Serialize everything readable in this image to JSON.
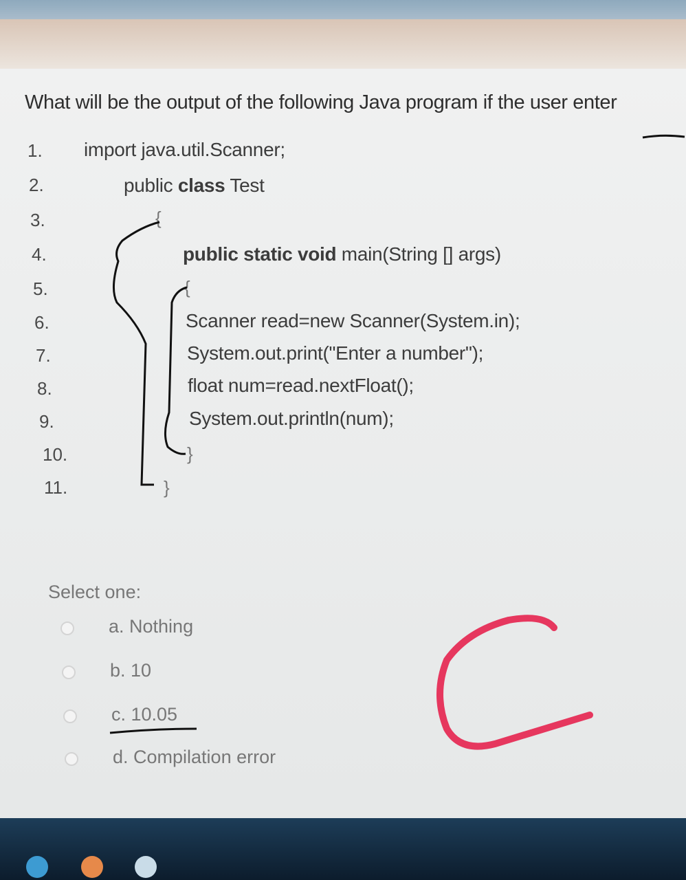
{
  "question": "What will be the output of the following Java program if the user enter",
  "code_lines": [
    {
      "n": "1.",
      "text": "import java.util.Scanner;"
    },
    {
      "n": "2.",
      "pre": "public ",
      "bold": "class",
      "post": " Test"
    },
    {
      "n": "3.",
      "text": ""
    },
    {
      "n": "4.",
      "bold": "public static void",
      "post": " main(String [] args)"
    },
    {
      "n": "5.",
      "text": ""
    },
    {
      "n": "6.",
      "text": "Scanner read=new Scanner(System.in);"
    },
    {
      "n": "7.",
      "text": "System.out.print(\"Enter a number\");"
    },
    {
      "n": "8.",
      "text": "float num=read.nextFloat();"
    },
    {
      "n": "9.",
      "text": "System.out.println(num);"
    },
    {
      "n": "10.",
      "text": ""
    },
    {
      "n": "11.",
      "text": ""
    }
  ],
  "select_label": "Select one:",
  "options": [
    {
      "label": "a. Nothing"
    },
    {
      "label": "b. 10"
    },
    {
      "label": "c. 10.05"
    },
    {
      "label": "d. Compilation error"
    }
  ],
  "braces": {
    "open": "{",
    "close": "}"
  },
  "annotation_letter": "C",
  "colors": {
    "annotation": "#e6375e",
    "ink": "#111111"
  }
}
